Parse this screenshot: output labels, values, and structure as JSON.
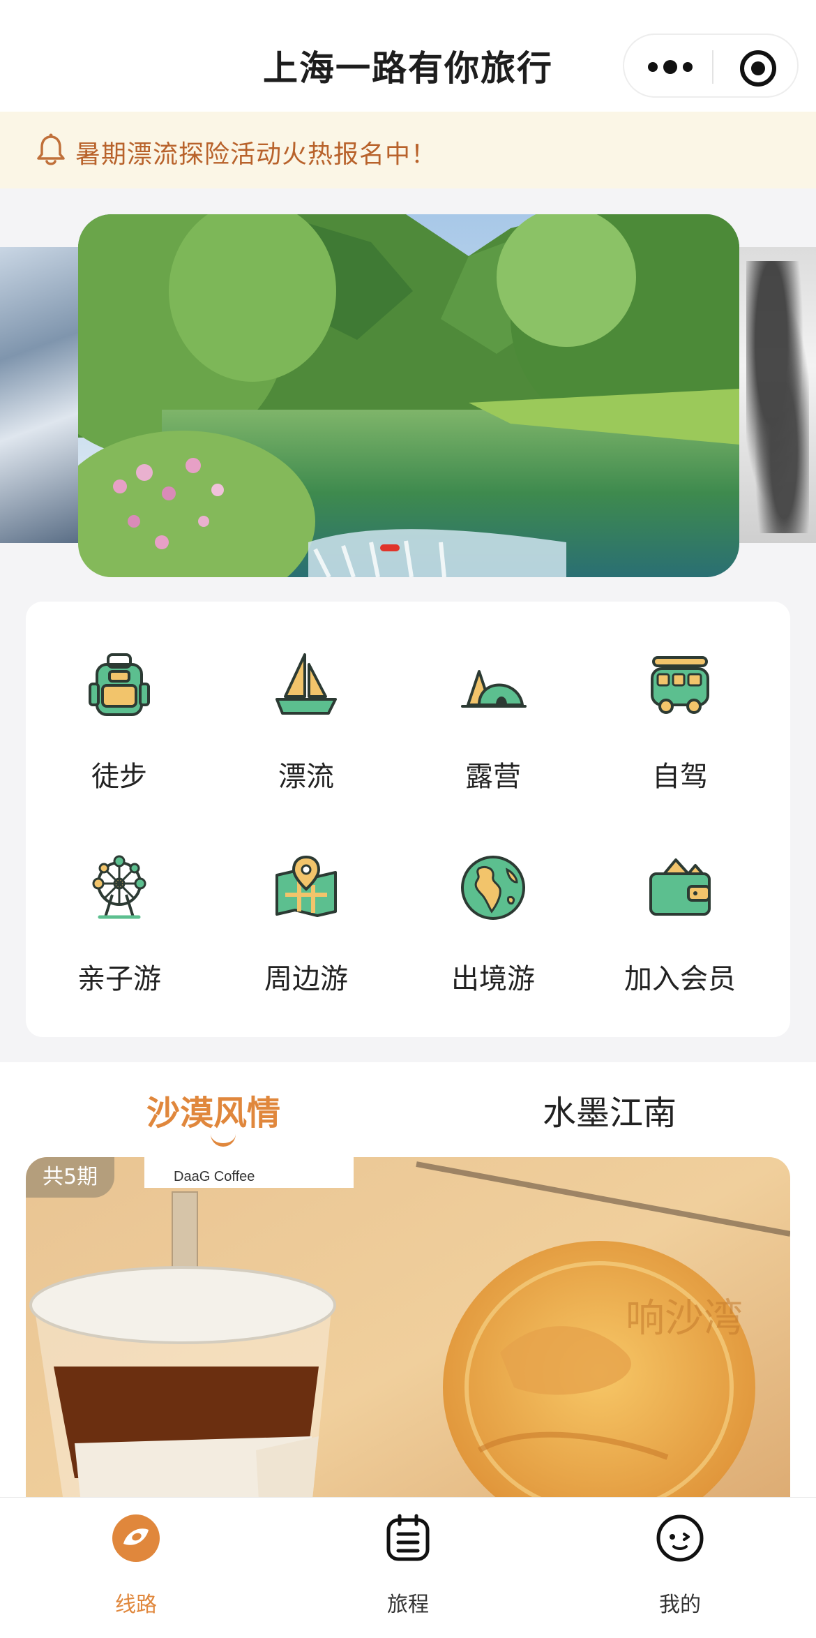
{
  "header": {
    "title": "上海一路有你旅行"
  },
  "notice": {
    "text": "暑期漂流探险活动火热报名中！"
  },
  "categories": [
    {
      "label": "徒步",
      "icon": "backpack-icon"
    },
    {
      "label": "漂流",
      "icon": "sailboat-icon"
    },
    {
      "label": "露营",
      "icon": "tent-icon"
    },
    {
      "label": "自驾",
      "icon": "camper-van-icon"
    },
    {
      "label": "亲子游",
      "icon": "ferris-wheel-icon"
    },
    {
      "label": "周边游",
      "icon": "map-pin-icon"
    },
    {
      "label": "出境游",
      "icon": "globe-icon"
    },
    {
      "label": "加入会员",
      "icon": "wallet-icon"
    }
  ],
  "tabs": [
    {
      "label": "沙漠风情",
      "active": true
    },
    {
      "label": "水墨江南",
      "active": false
    }
  ],
  "feature": {
    "badge": "共5期",
    "cup_text": "DaaG Coffee",
    "cookie_text": "响沙湾"
  },
  "tabbar": [
    {
      "label": "线路",
      "icon": "route-icon",
      "active": true
    },
    {
      "label": "旅程",
      "icon": "itinerary-icon",
      "active": false
    },
    {
      "label": "我的",
      "icon": "profile-icon",
      "active": false
    }
  ],
  "colors": {
    "accent": "#e0873c",
    "notice_text": "#b8622b",
    "notice_bg": "#fbf6e6",
    "icon_green": "#5cbf8f",
    "icon_yellow": "#f2c46b",
    "carousel_dot": "#e0352b"
  }
}
